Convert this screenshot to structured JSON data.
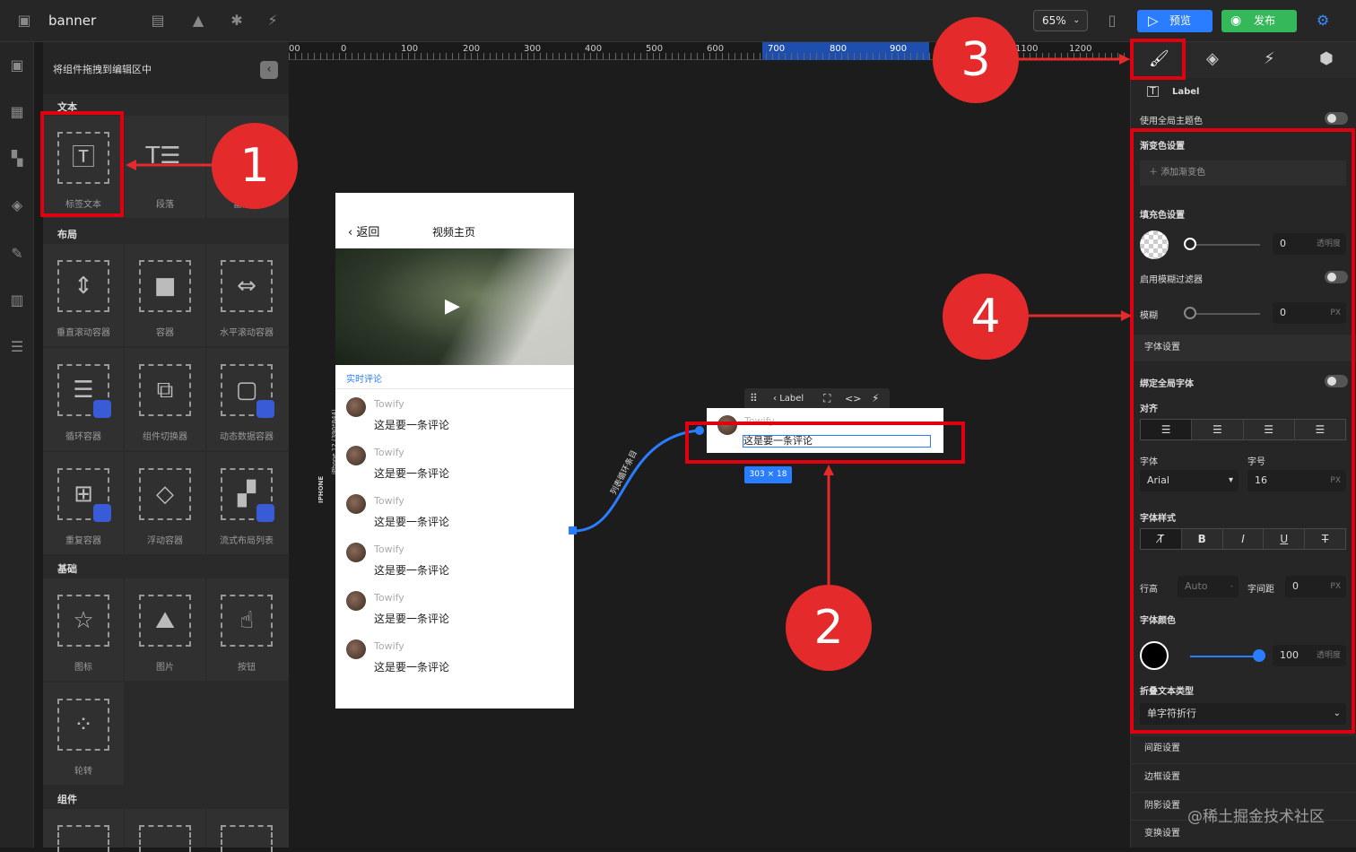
{
  "app": {
    "title": "banner",
    "zoom": "65%",
    "preview": "预览",
    "publish": "发布"
  },
  "library": {
    "header": "将组件拖拽到编辑区中",
    "sections": {
      "text": "文本",
      "layout": "布局",
      "basic": "基础",
      "components": "组件"
    },
    "text_items": [
      "标签文本",
      "段落",
      "富文本"
    ],
    "layout_items": [
      "垂直滚动容器",
      "容器",
      "水平滚动容器",
      "循环容器",
      "组件切换器",
      "动态数据容器",
      "重复容器",
      "浮动容器",
      "流式布局列表"
    ],
    "basic_items": [
      "图标",
      "图片",
      "按钮",
      "轮转"
    ]
  },
  "ruler": {
    "ticks": [
      "00",
      "0",
      "100",
      "200",
      "300",
      "400",
      "500",
      "600",
      "700",
      "800",
      "900",
      "1100",
      "1200"
    ]
  },
  "device_label": "iPhone 12 (390*844)",
  "device_name": "IPHONE",
  "phone": {
    "back": "返回",
    "title": "视频主页",
    "section": "实时评论",
    "comments": [
      {
        "user": "Towify",
        "text": "这是要一条评论"
      },
      {
        "user": "Towify",
        "text": "这是要一条评论"
      },
      {
        "user": "Towify",
        "text": "这是要一条评论"
      },
      {
        "user": "Towify",
        "text": "这是要一条评论"
      },
      {
        "user": "Towify",
        "text": "这是要一条评论"
      },
      {
        "user": "Towify",
        "text": "这是要一条评论"
      }
    ]
  },
  "float": {
    "toolbar_label": "Label",
    "user": "Towify",
    "text": "这是要一条评论",
    "size": "303 × 18",
    "link_label": "列表循环条目"
  },
  "inspector": {
    "component": "Label",
    "use_theme": "使用全局主题色",
    "gradient": "渐变色设置",
    "add_gradient": "添加渐变色",
    "fill": "填充色设置",
    "fill_value": "0",
    "opacity_ph": "透明度",
    "blur_filter": "启用模糊过滤器",
    "blur": "模糊",
    "blur_value": "0",
    "px": "PX",
    "font_settings": "字体设置",
    "bind_font": "绑定全局字体",
    "align": "对齐",
    "font": "字体",
    "font_value": "Arial",
    "size": "字号",
    "size_value": "16",
    "font_style": "字体样式",
    "line_height": "行高",
    "line_height_value": "Auto",
    "letter_spacing": "字间距",
    "letter_spacing_value": "0",
    "font_color": "字体颜色",
    "font_color_value": "100",
    "font_color_hex": "#000000",
    "wrap_type": "折叠文本类型",
    "wrap_value": "单字符折行",
    "collapsed": [
      "间距设置",
      "边框设置",
      "阴影设置",
      "变换设置"
    ]
  },
  "badges": [
    "1",
    "2",
    "3",
    "4"
  ],
  "watermark": "@稀土掘金技术社区"
}
